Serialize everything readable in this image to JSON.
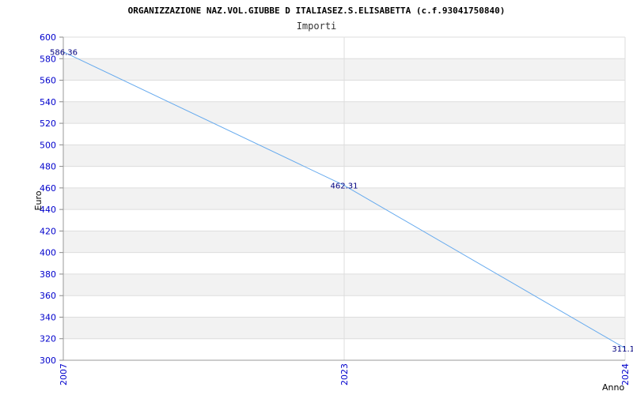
{
  "chart_data": {
    "type": "line",
    "title": "ORGANIZZAZIONE NAZ.VOL.GIUBBE D ITALIASEZ.S.ELISABETTA (c.f.93041750840)",
    "subtitle": "Importi",
    "xlabel": "Anno",
    "ylabel": "Euro",
    "categories": [
      "2007",
      "2023",
      "2024"
    ],
    "values": [
      586.36,
      462.31,
      311.1
    ],
    "data_labels": [
      "586.36",
      "462.31",
      "311.1"
    ],
    "ylim": [
      300,
      600
    ],
    "yticks": [
      "300",
      "320",
      "340",
      "360",
      "380",
      "400",
      "420",
      "440",
      "460",
      "480",
      "500",
      "520",
      "540",
      "560",
      "580",
      "600"
    ],
    "grid": true,
    "line_color": "#66aaee",
    "band_color": "#f2f2f2",
    "tick_color": "#0000cc"
  }
}
